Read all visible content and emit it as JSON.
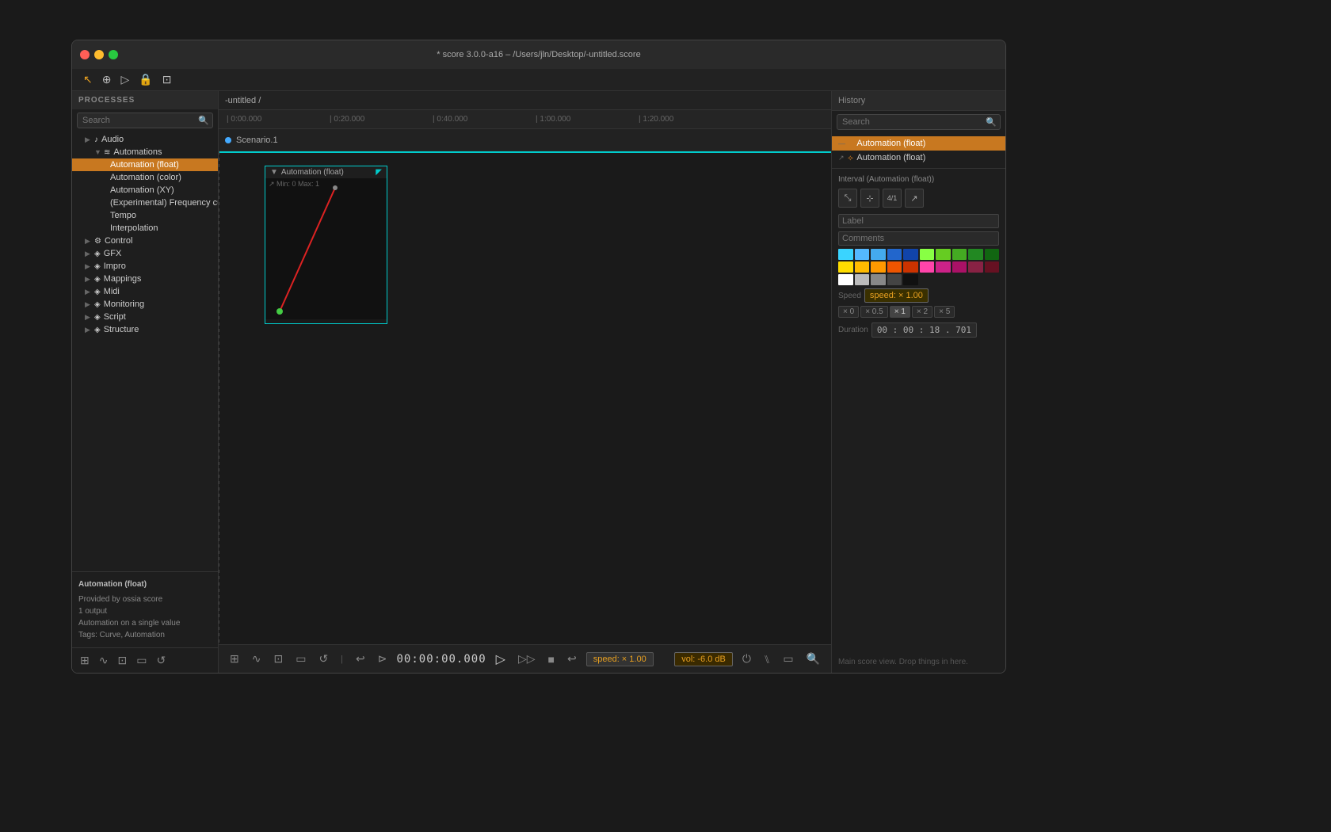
{
  "window": {
    "title": "* score 3.0.0-a16 – /Users/jln/Desktop/-untitled.score"
  },
  "top_toolbar": {
    "buttons": [
      "cursor",
      "add",
      "play",
      "lock",
      "select"
    ]
  },
  "timeline": {
    "marks": [
      "0:00.000",
      "0:20.000",
      "0:40.000",
      "1:00.000",
      "1:20.000"
    ]
  },
  "breadcrumb": "-untitled /",
  "scenario": {
    "label": "Scenario.1"
  },
  "processes_panel": {
    "header": "PROCESSES",
    "search_placeholder": "Search",
    "tree": [
      {
        "id": "audio",
        "label": "Audio",
        "indent": 1,
        "icon": "♪",
        "arrow": "▶",
        "has_children": true
      },
      {
        "id": "automations",
        "label": "Automations",
        "indent": 2,
        "icon": "≋",
        "arrow": "▼",
        "has_children": true
      },
      {
        "id": "automation-float",
        "label": "Automation (float)",
        "indent": 3,
        "icon": "",
        "arrow": "",
        "active": true
      },
      {
        "id": "automation-color",
        "label": "Automation (color)",
        "indent": 3,
        "icon": "",
        "arrow": ""
      },
      {
        "id": "automation-xy",
        "label": "Automation (XY)",
        "indent": 3,
        "icon": "",
        "arrow": ""
      },
      {
        "id": "freq-curve",
        "label": "(Experimental) Frequency curve",
        "indent": 3,
        "icon": "",
        "arrow": ""
      },
      {
        "id": "tempo",
        "label": "Tempo",
        "indent": 3,
        "icon": "",
        "arrow": ""
      },
      {
        "id": "interpolation",
        "label": "Interpolation",
        "indent": 3,
        "icon": "",
        "arrow": ""
      },
      {
        "id": "control",
        "label": "Control",
        "indent": 1,
        "icon": "⚙",
        "arrow": "▶",
        "has_children": true
      },
      {
        "id": "gfx",
        "label": "GFX",
        "indent": 1,
        "icon": "◈",
        "arrow": "▶",
        "has_children": true
      },
      {
        "id": "impro",
        "label": "Impro",
        "indent": 1,
        "icon": "◈",
        "arrow": "▶",
        "has_children": true
      },
      {
        "id": "mappings",
        "label": "Mappings",
        "indent": 1,
        "icon": "◈",
        "arrow": "▶",
        "has_children": true
      },
      {
        "id": "midi",
        "label": "Midi",
        "indent": 1,
        "icon": "◈",
        "arrow": "▶",
        "has_children": true
      },
      {
        "id": "monitoring",
        "label": "Monitoring",
        "indent": 1,
        "icon": "◈",
        "arrow": "▶",
        "has_children": true
      },
      {
        "id": "script",
        "label": "Script",
        "indent": 1,
        "icon": "◈",
        "arrow": "▶",
        "has_children": true
      },
      {
        "id": "structure",
        "label": "Structure",
        "indent": 1,
        "icon": "◈",
        "arrow": "▶",
        "has_children": true
      }
    ]
  },
  "sidebar_info": {
    "title": "Automation (float)",
    "provided": "Provided by ossia score",
    "outputs": "1 output",
    "description": "Automation on a single value",
    "tags": "Tags: Curve, Automation"
  },
  "automation_block": {
    "title": "Automation (float)",
    "label": "↗ Min: 0  Max: 1"
  },
  "history_panel": {
    "header": "History",
    "search_placeholder": "Search",
    "items": [
      {
        "label": "Automation (float)",
        "active": true,
        "icon": "—"
      },
      {
        "label": "Automation (float)",
        "active": false,
        "icon": "↗"
      }
    ]
  },
  "interval_section": {
    "title": "Interval (Automation (float))",
    "icons": [
      "⤡",
      "⊹",
      "⁴⁄₁",
      "↗"
    ],
    "label_field": "Label",
    "comments_field": "Comments",
    "colors": [
      "#3ad4ff",
      "#54b8ff",
      "#44aaee",
      "#2266cc",
      "#1144aa",
      "#88ff44",
      "#66cc22",
      "#44aa22",
      "#228822",
      "#116611",
      "#ffdd00",
      "#ffbb00",
      "#ff9900",
      "#ee5500",
      "#cc3300",
      "#ff44aa",
      "#cc2288",
      "#aa1166",
      "#882244",
      "#661122",
      "#ffffff",
      "#bbbbbb",
      "#888888",
      "#444444",
      "#111111"
    ],
    "speed_label": "Speed",
    "speed_value": "speed: × 1.00",
    "speed_buttons": [
      "× 0",
      "× 0.5",
      "× 1",
      "× 2",
      "× 5"
    ],
    "duration_label": "Duration",
    "duration_value": "00 : 00 : 18 . 701"
  },
  "bottom_transport": {
    "time": "00:00:00.000",
    "speed": "speed: × 1.00",
    "vol": "vol: -6.0 dB",
    "icons": [
      "grid",
      "wave",
      "frame",
      "box",
      "history"
    ]
  },
  "drop_hint": "Main score view. Drop things in here."
}
